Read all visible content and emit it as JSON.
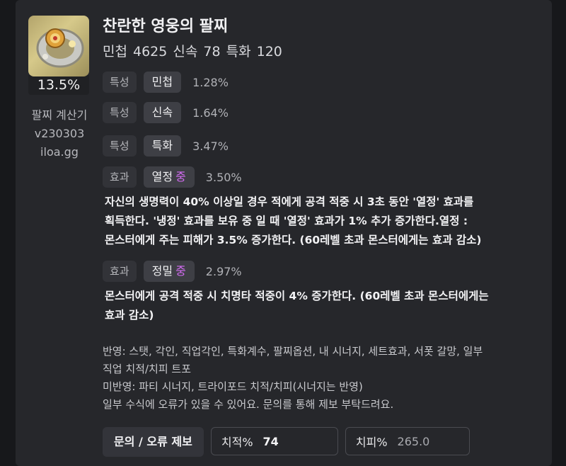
{
  "item": {
    "name": "찬란한 영웅의 팔찌",
    "stats": "민첩 4625  신속 78  특화 120",
    "percent": "13.5%",
    "image_icon": "bracelet-icon"
  },
  "calculator": {
    "title": "팔찌 계산기",
    "version": "v230303",
    "site": "iloa.gg"
  },
  "traits": [
    {
      "tag": "특성",
      "name": "민첩",
      "value": "1.28%"
    },
    {
      "tag": "특성",
      "name": "신속",
      "value": "1.64%"
    },
    {
      "tag": "특성",
      "name": "특화",
      "value": "3.47%"
    }
  ],
  "effects": [
    {
      "tag": "효과",
      "name": "열정",
      "grade": "중",
      "value": "3.50%",
      "desc_lines": [
        "자신의 생명력이 40% 이상일 경우 적에게 공격 적중 시 3초 동안 '열정' 효과를",
        "획득한다. '냉정' 효과를 보유 중 일 때 '열정' 효과가 1% 추가 증가한다.열정 :",
        "몬스터에게 주는 피해가 3.5% 증가한다. (60레벨 초과 몬스터에게는 효과 감소)"
      ]
    },
    {
      "tag": "효과",
      "name": "정밀",
      "grade": "중",
      "value": "2.97%",
      "desc_lines": [
        "몬스터에게 공격 적중 시 치명타 적중이 4% 증가한다. (60레벨 초과 몬스터에게는",
        "효과 감소)"
      ]
    }
  ],
  "notes": [
    "반영: 스탯, 각인, 직업각인, 특화계수, 팔찌옵션, 내 시너지, 세트효과, 서폿 갈망, 일부",
    "직업 치적/치피 트포",
    "미반영: 파티 시너지, 트라이포드 치적/치피(시너지는 반영)",
    "일부 수식에 오류가 있을 수 있어요. 문의를 통해 제보 부탁드려요."
  ],
  "footer": {
    "report_button": "문의 / 오류 제보",
    "crit_rate_label": "치적%",
    "crit_rate_value": "74",
    "crit_dmg_label": "치피%",
    "crit_dmg_value": "265.0"
  },
  "colors": {
    "grade": "#d56cf5",
    "background": "#26272b"
  }
}
